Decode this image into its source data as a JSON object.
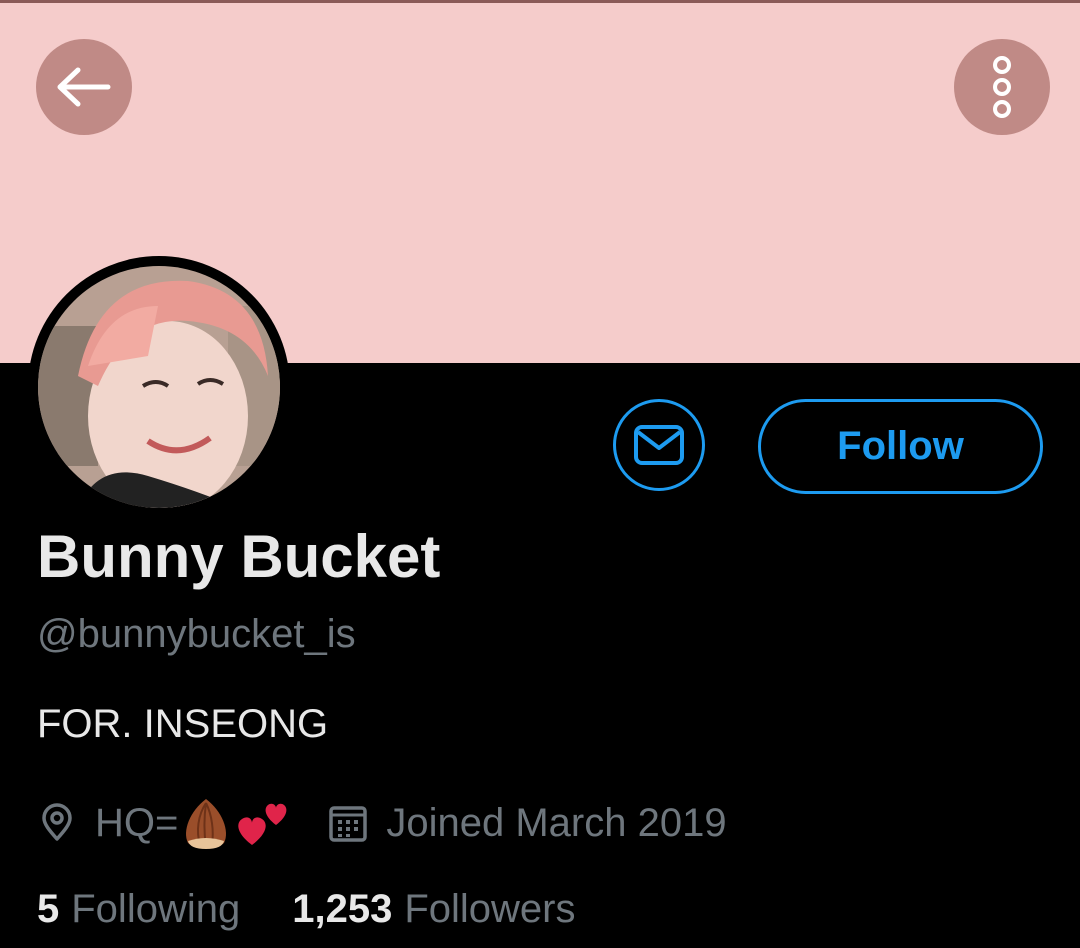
{
  "header": {
    "back_icon": "arrow-left-icon",
    "more_icon": "more-vertical-icon",
    "banner_color": "#f5cccb",
    "button_color": "#c08a86"
  },
  "profile": {
    "name": "Bunny Bucket",
    "handle": "@bunnybucket_is",
    "bio": "FOR. INSEONG",
    "location_prefix": "HQ=",
    "location_emojis": [
      "almond-emoji",
      "two-hearts-emoji"
    ],
    "joined": "Joined March 2019",
    "following_count": "5",
    "following_label": "Following",
    "followers_count": "1,253",
    "followers_label": "Followers"
  },
  "actions": {
    "message_icon": "envelope-icon",
    "follow_label": "Follow",
    "accent_color": "#1d9bf0"
  }
}
